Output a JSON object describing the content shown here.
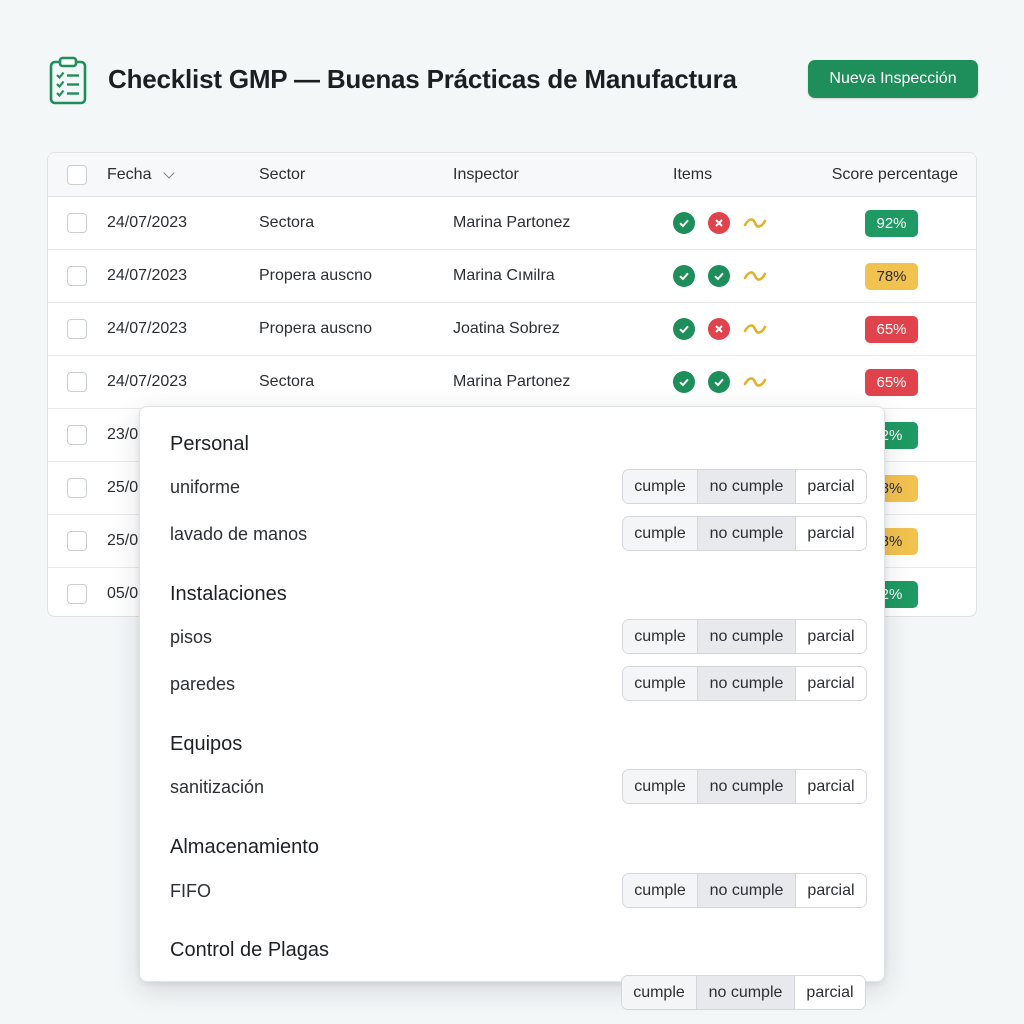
{
  "app": {
    "title": "Checklist GMP — Buenas Prácticas de Manufactura",
    "new_button": "Nueva Inspección",
    "icon": "clipboard-checklist-icon",
    "accent_color": "#1e8e5a"
  },
  "table": {
    "headers": {
      "fecha": "Fecha",
      "sector": "Sector",
      "inspector": "Inspector",
      "items": "Items",
      "score": "Score percentage"
    },
    "rows": [
      {
        "fecha": "24/07/2023",
        "sector": "Sectora",
        "inspector": "Marina Partonez",
        "items": [
          "ok",
          "bad",
          "part"
        ],
        "score": "92%",
        "score_color": "green"
      },
      {
        "fecha": "24/07/2023",
        "sector": "Propera auscno",
        "inspector": "Marina Cıмilra",
        "items": [
          "ok",
          "ok",
          "part"
        ],
        "score": "78%",
        "score_color": "yellow"
      },
      {
        "fecha": "24/07/2023",
        "sector": "Propera auscno",
        "inspector": "Joatina Sobrez",
        "items": [
          "ok",
          "bad",
          "part"
        ],
        "score": "65%",
        "score_color": "red"
      },
      {
        "fecha": "24/07/2023",
        "sector": "Sectora",
        "inspector": "Marina Partonez",
        "items": [
          "ok",
          "ok",
          "part"
        ],
        "score": "65%",
        "score_color": "red"
      },
      {
        "fecha": "23/0",
        "score": "2%",
        "score_color": "green"
      },
      {
        "fecha": "25/0",
        "score": "8%",
        "score_color": "yellow"
      },
      {
        "fecha": "25/0",
        "score": "8%",
        "score_color": "yellow"
      },
      {
        "fecha": "05/0",
        "score": "2%",
        "score_color": "green"
      }
    ]
  },
  "checklist": {
    "options": [
      "cumple",
      "no cumple",
      "parcial"
    ],
    "sections": {
      "personal": {
        "title": "Personal",
        "items": [
          "uniforme",
          "lavado de manos"
        ]
      },
      "instalaciones": {
        "title": "Instalaciones",
        "items": [
          "pisos",
          "paredes"
        ]
      },
      "equipos": {
        "title": "Equipos",
        "items": [
          "sanitización"
        ]
      },
      "almacenamiento": {
        "title": "Almacenamiento",
        "items": [
          "FIFO"
        ]
      },
      "plagas": {
        "title": "Control de Plagas",
        "items": []
      }
    }
  }
}
